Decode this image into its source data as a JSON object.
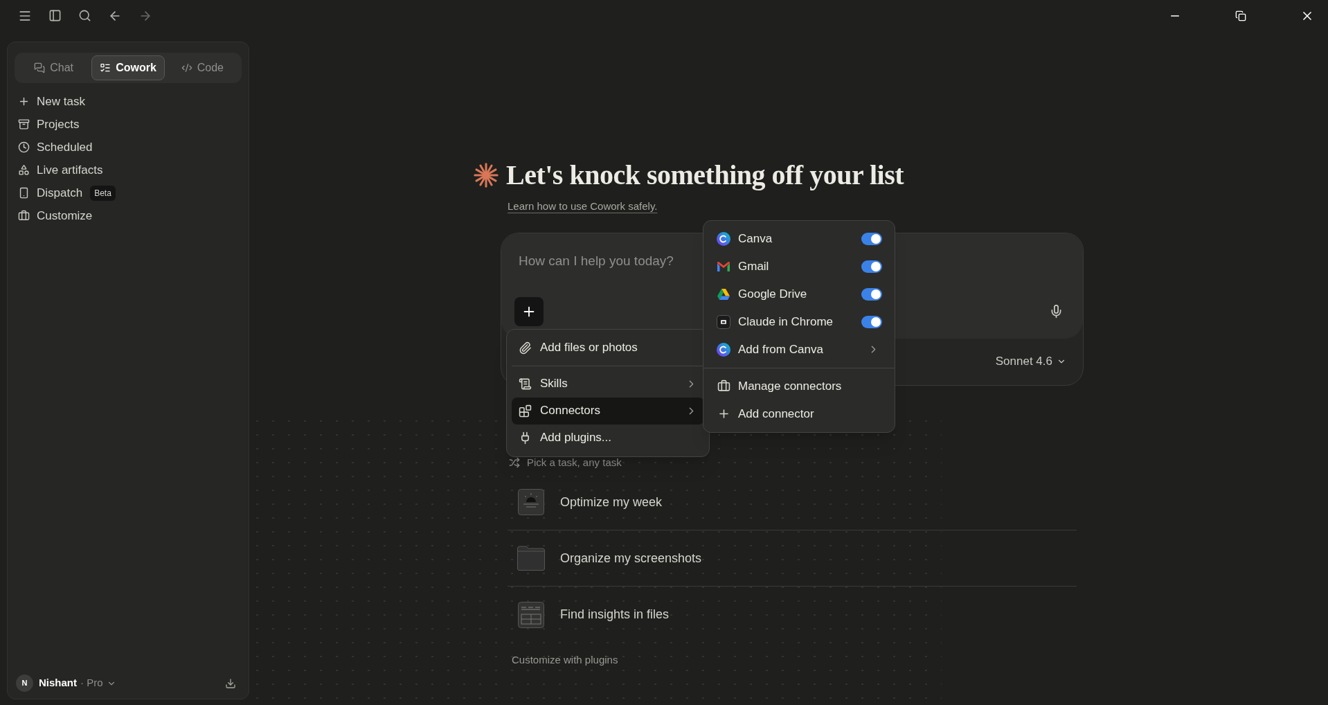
{
  "sidebar": {
    "tabs": [
      {
        "label": "Chat",
        "selected": false
      },
      {
        "label": "Cowork",
        "selected": true
      },
      {
        "label": "Code",
        "selected": false
      }
    ],
    "items": [
      {
        "label": "New task"
      },
      {
        "label": "Projects"
      },
      {
        "label": "Scheduled"
      },
      {
        "label": "Live artifacts"
      },
      {
        "label": "Dispatch",
        "badge": "Beta"
      },
      {
        "label": "Customize"
      }
    ],
    "user": {
      "initial": "N",
      "name": "Nishant",
      "plan": "· Pro"
    }
  },
  "main": {
    "heading": "Let's knock something off your list",
    "link": "Learn how to use Cowork safely.",
    "input": {
      "placeholder": "How can I help you today?",
      "model": "Sonnet 4.6"
    },
    "attach_menu": {
      "groups": [
        [
          {
            "label": "Add files or photos",
            "submenu": false,
            "selected": false
          }
        ],
        [
          {
            "label": "Skills",
            "submenu": true,
            "selected": false
          },
          {
            "label": "Connectors",
            "submenu": true,
            "selected": true
          },
          {
            "label": "Add plugins...",
            "submenu": false,
            "selected": false
          }
        ]
      ]
    },
    "connectors_menu": {
      "connectors": [
        {
          "name": "Canva",
          "kind": "toggle",
          "on": true
        },
        {
          "name": "Gmail",
          "kind": "toggle",
          "on": true
        },
        {
          "name": "Google Drive",
          "kind": "toggle",
          "on": true
        },
        {
          "name": "Claude in Chrome",
          "kind": "toggle",
          "on": true
        },
        {
          "name": "Add from Canva",
          "kind": "submenu"
        }
      ],
      "actions": [
        {
          "label": "Manage connectors"
        },
        {
          "label": "Add connector"
        }
      ]
    },
    "pick_task": "Pick a task, any task",
    "tasks": [
      {
        "label": "Optimize my week"
      },
      {
        "label": "Organize my screenshots"
      },
      {
        "label": "Find insights in files"
      }
    ],
    "footer_link": "Customize with plugins"
  }
}
